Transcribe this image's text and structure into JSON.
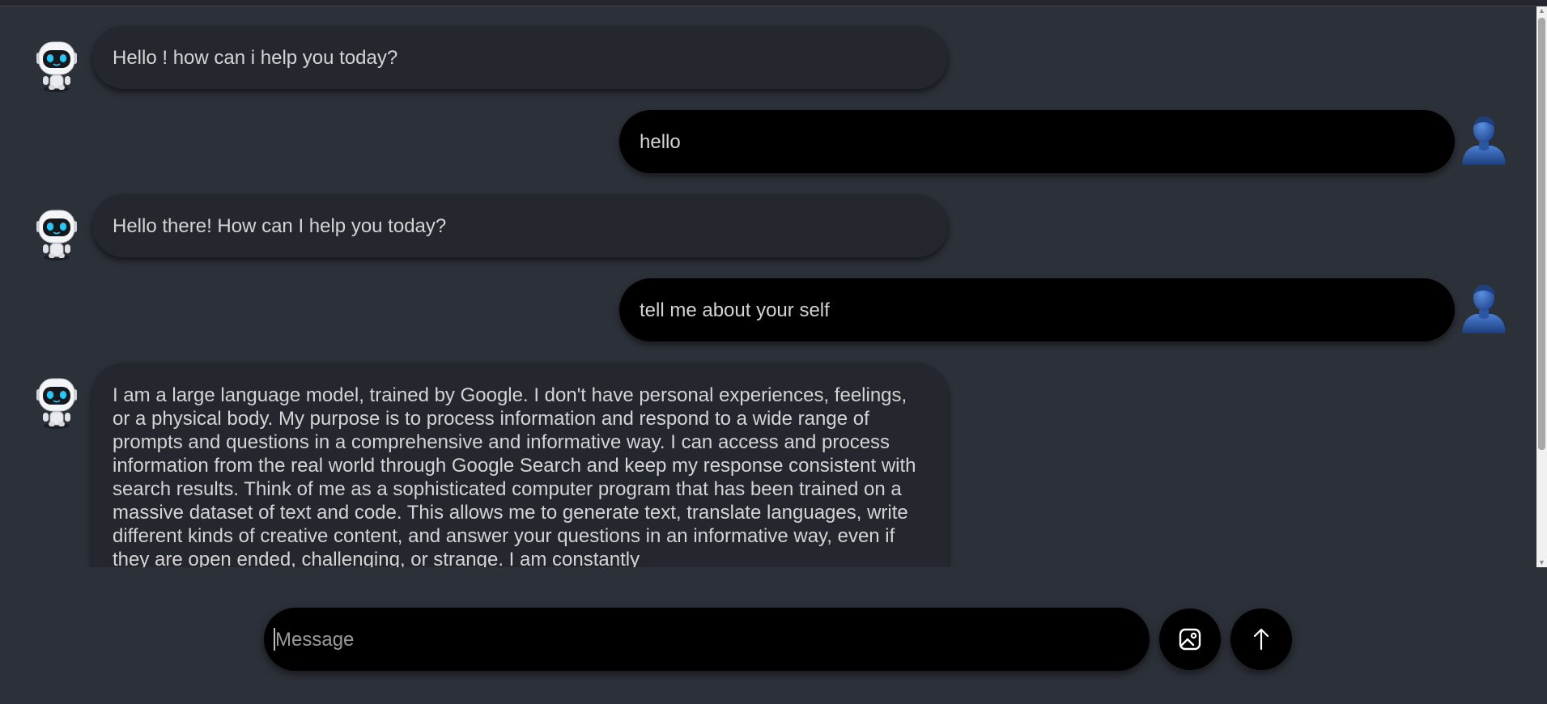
{
  "messages": [
    {
      "role": "bot",
      "text": "Hello ! how can i help you today?"
    },
    {
      "role": "user",
      "text": "hello"
    },
    {
      "role": "bot",
      "text": "Hello there! How can I help you today?"
    },
    {
      "role": "user",
      "text": "tell me about your self"
    },
    {
      "role": "bot",
      "text": "I am a large language model, trained by Google. I don't have personal experiences, feelings, or a physical body. My purpose is to process information and respond to a wide range of prompts and questions in a comprehensive and informative way. I can access and process information from the real world through Google Search and keep my response consistent with search results. Think of me as a sophisticated computer program that has been trained on a massive dataset of text and code. This allows me to generate text, translate languages, write different kinds of creative content, and answer your questions in an informative way, even if they are open ended, challenging, or strange. I am constantly"
    }
  ],
  "composer": {
    "placeholder": "Message",
    "value": ""
  },
  "icons": {
    "bot_avatar": "robot-icon",
    "user_avatar": "user-silhouette-icon",
    "attach": "image-icon",
    "send": "arrow-up-icon"
  },
  "colors": {
    "background": "#2c3038",
    "bot_bubble": "#24272d",
    "user_bubble": "#000000",
    "text": "#d4d4d6",
    "avatar_blue": "#2f63b8"
  }
}
